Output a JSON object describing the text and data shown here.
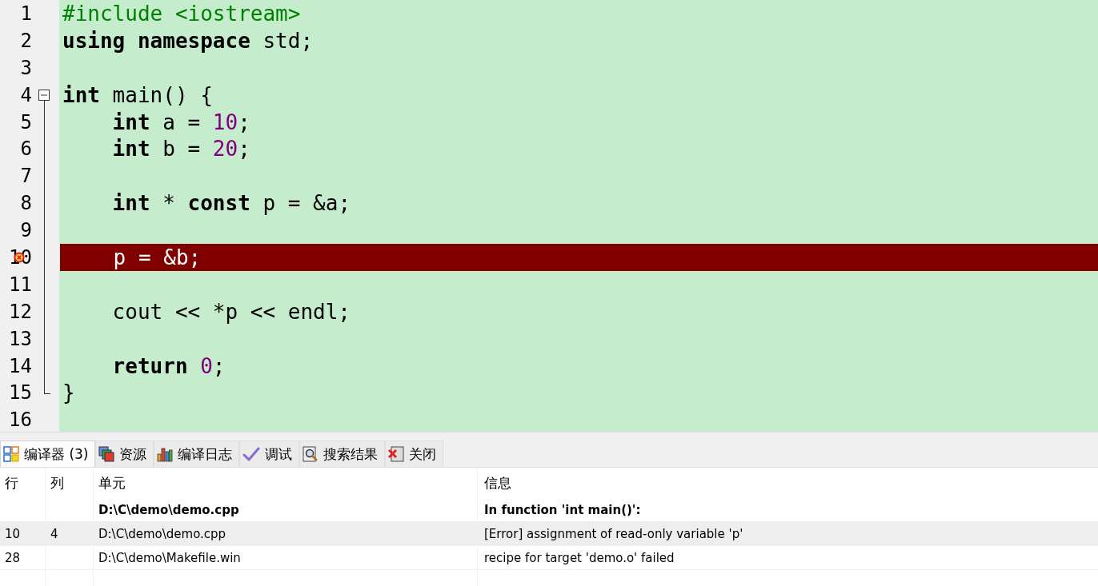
{
  "editor": {
    "lines": [
      {
        "number": "1",
        "error": false,
        "tokens": [
          {
            "kind": "preproc",
            "text": "#include <iostream>"
          }
        ]
      },
      {
        "number": "2",
        "error": false,
        "tokens": [
          {
            "kind": "keyword",
            "text": "using namespace"
          },
          {
            "kind": "plain",
            "text": " std;"
          }
        ]
      },
      {
        "number": "3",
        "error": false
      },
      {
        "number": "4",
        "error": false,
        "expanded": true,
        "tokens": [
          {
            "kind": "keyword",
            "text": "int"
          },
          {
            "kind": "plain",
            "text": " main() {"
          }
        ],
        "children": [
          {
            "number": "5",
            "error": false,
            "tokens": [
              {
                "kind": "keyword",
                "text": "    int"
              },
              {
                "kind": "plain",
                "text": " a = "
              },
              {
                "kind": "number",
                "text": "10"
              },
              {
                "kind": "plain",
                "text": ";"
              }
            ]
          },
          {
            "number": "6",
            "error": false,
            "tokens": [
              {
                "kind": "keyword",
                "text": "    int"
              },
              {
                "kind": "plain",
                "text": " b = "
              },
              {
                "kind": "number",
                "text": "20"
              },
              {
                "kind": "plain",
                "text": ";"
              }
            ]
          },
          {
            "number": "7",
            "error": false
          },
          {
            "number": "8",
            "error": false,
            "tokens": [
              {
                "kind": "keyword",
                "text": "    int"
              },
              {
                "kind": "plain",
                "text": " * "
              },
              {
                "kind": "keyword",
                "text": "const"
              },
              {
                "kind": "plain",
                "text": " p = &a;"
              }
            ]
          },
          {
            "number": "9",
            "error": false
          },
          {
            "number": "10",
            "error": true,
            "tokens": [
              {
                "kind": "plain",
                "text": "    p = &b;"
              }
            ]
          },
          {
            "number": "11",
            "error": false
          },
          {
            "number": "12",
            "error": false,
            "tokens": [
              {
                "kind": "plain",
                "text": "    cout << *p << endl;"
              }
            ]
          },
          {
            "number": "13",
            "error": false
          },
          {
            "number": "14",
            "error": false,
            "tokens": [
              {
                "kind": "keyword",
                "text": "    return "
              },
              {
                "kind": "number",
                "text": "0"
              },
              {
                "kind": "plain",
                "text": ";"
              }
            ]
          },
          {
            "number": "15",
            "error": false,
            "tokens": [
              {
                "kind": "plain",
                "text": "}"
              }
            ]
          }
        ]
      },
      {
        "number": "16",
        "error": false
      }
    ]
  },
  "panel": {
    "tabs": [
      {
        "kind": "compiler",
        "label": "编译器 (3)",
        "selected": true
      },
      {
        "kind": "resources",
        "label": "资源",
        "selected": false
      },
      {
        "kind": "log",
        "label": "编译日志",
        "selected": false
      },
      {
        "kind": "debug",
        "label": "调试",
        "selected": false
      },
      {
        "kind": "search",
        "label": "搜索结果",
        "selected": false
      },
      {
        "kind": "close",
        "label": "关闭",
        "selected": false
      }
    ],
    "table": {
      "columns": [
        "行",
        "列",
        "单元",
        "信息"
      ],
      "rows": [
        {
          "unit": "D:\\C\\demo\\demo.cpp",
          "message": "In function 'int main()':",
          "bold": true,
          "selected": false
        },
        {
          "line": "10",
          "column": "4",
          "unit": "D:\\C\\demo\\demo.cpp",
          "message": "[Error] assignment of read-only variable 'p'",
          "bold": false,
          "selected": true
        },
        {
          "line": "28",
          "unit": "D:\\C\\demo\\Makefile.win",
          "message": "recipe for target 'demo.o' failed",
          "bold": false,
          "selected": false
        }
      ]
    }
  }
}
